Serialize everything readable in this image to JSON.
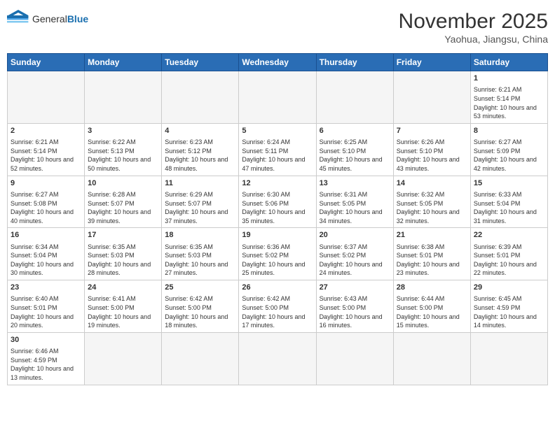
{
  "header": {
    "logo_general": "General",
    "logo_blue": "Blue",
    "month_year": "November 2025",
    "location": "Yaohua, Jiangsu, China"
  },
  "days_of_week": [
    "Sunday",
    "Monday",
    "Tuesday",
    "Wednesday",
    "Thursday",
    "Friday",
    "Saturday"
  ],
  "weeks": [
    [
      {
        "day": "",
        "info": ""
      },
      {
        "day": "",
        "info": ""
      },
      {
        "day": "",
        "info": ""
      },
      {
        "day": "",
        "info": ""
      },
      {
        "day": "",
        "info": ""
      },
      {
        "day": "",
        "info": ""
      },
      {
        "day": "1",
        "info": "Sunrise: 6:21 AM\nSunset: 5:14 PM\nDaylight: 10 hours and 53 minutes."
      }
    ],
    [
      {
        "day": "2",
        "info": "Sunrise: 6:21 AM\nSunset: 5:14 PM\nDaylight: 10 hours and 52 minutes."
      },
      {
        "day": "3",
        "info": "Sunrise: 6:22 AM\nSunset: 5:13 PM\nDaylight: 10 hours and 50 minutes."
      },
      {
        "day": "4",
        "info": "Sunrise: 6:23 AM\nSunset: 5:12 PM\nDaylight: 10 hours and 48 minutes."
      },
      {
        "day": "5",
        "info": "Sunrise: 6:24 AM\nSunset: 5:11 PM\nDaylight: 10 hours and 47 minutes."
      },
      {
        "day": "6",
        "info": "Sunrise: 6:25 AM\nSunset: 5:10 PM\nDaylight: 10 hours and 45 minutes."
      },
      {
        "day": "7",
        "info": "Sunrise: 6:26 AM\nSunset: 5:10 PM\nDaylight: 10 hours and 43 minutes."
      },
      {
        "day": "8",
        "info": "Sunrise: 6:27 AM\nSunset: 5:09 PM\nDaylight: 10 hours and 42 minutes."
      }
    ],
    [
      {
        "day": "9",
        "info": "Sunrise: 6:27 AM\nSunset: 5:08 PM\nDaylight: 10 hours and 40 minutes."
      },
      {
        "day": "10",
        "info": "Sunrise: 6:28 AM\nSunset: 5:07 PM\nDaylight: 10 hours and 39 minutes."
      },
      {
        "day": "11",
        "info": "Sunrise: 6:29 AM\nSunset: 5:07 PM\nDaylight: 10 hours and 37 minutes."
      },
      {
        "day": "12",
        "info": "Sunrise: 6:30 AM\nSunset: 5:06 PM\nDaylight: 10 hours and 35 minutes."
      },
      {
        "day": "13",
        "info": "Sunrise: 6:31 AM\nSunset: 5:05 PM\nDaylight: 10 hours and 34 minutes."
      },
      {
        "day": "14",
        "info": "Sunrise: 6:32 AM\nSunset: 5:05 PM\nDaylight: 10 hours and 32 minutes."
      },
      {
        "day": "15",
        "info": "Sunrise: 6:33 AM\nSunset: 5:04 PM\nDaylight: 10 hours and 31 minutes."
      }
    ],
    [
      {
        "day": "16",
        "info": "Sunrise: 6:34 AM\nSunset: 5:04 PM\nDaylight: 10 hours and 30 minutes."
      },
      {
        "day": "17",
        "info": "Sunrise: 6:35 AM\nSunset: 5:03 PM\nDaylight: 10 hours and 28 minutes."
      },
      {
        "day": "18",
        "info": "Sunrise: 6:35 AM\nSunset: 5:03 PM\nDaylight: 10 hours and 27 minutes."
      },
      {
        "day": "19",
        "info": "Sunrise: 6:36 AM\nSunset: 5:02 PM\nDaylight: 10 hours and 25 minutes."
      },
      {
        "day": "20",
        "info": "Sunrise: 6:37 AM\nSunset: 5:02 PM\nDaylight: 10 hours and 24 minutes."
      },
      {
        "day": "21",
        "info": "Sunrise: 6:38 AM\nSunset: 5:01 PM\nDaylight: 10 hours and 23 minutes."
      },
      {
        "day": "22",
        "info": "Sunrise: 6:39 AM\nSunset: 5:01 PM\nDaylight: 10 hours and 22 minutes."
      }
    ],
    [
      {
        "day": "23",
        "info": "Sunrise: 6:40 AM\nSunset: 5:01 PM\nDaylight: 10 hours and 20 minutes."
      },
      {
        "day": "24",
        "info": "Sunrise: 6:41 AM\nSunset: 5:00 PM\nDaylight: 10 hours and 19 minutes."
      },
      {
        "day": "25",
        "info": "Sunrise: 6:42 AM\nSunset: 5:00 PM\nDaylight: 10 hours and 18 minutes."
      },
      {
        "day": "26",
        "info": "Sunrise: 6:42 AM\nSunset: 5:00 PM\nDaylight: 10 hours and 17 minutes."
      },
      {
        "day": "27",
        "info": "Sunrise: 6:43 AM\nSunset: 5:00 PM\nDaylight: 10 hours and 16 minutes."
      },
      {
        "day": "28",
        "info": "Sunrise: 6:44 AM\nSunset: 5:00 PM\nDaylight: 10 hours and 15 minutes."
      },
      {
        "day": "29",
        "info": "Sunrise: 6:45 AM\nSunset: 4:59 PM\nDaylight: 10 hours and 14 minutes."
      }
    ],
    [
      {
        "day": "30",
        "info": "Sunrise: 6:46 AM\nSunset: 4:59 PM\nDaylight: 10 hours and 13 minutes."
      },
      {
        "day": "",
        "info": ""
      },
      {
        "day": "",
        "info": ""
      },
      {
        "day": "",
        "info": ""
      },
      {
        "day": "",
        "info": ""
      },
      {
        "day": "",
        "info": ""
      },
      {
        "day": "",
        "info": ""
      }
    ]
  ]
}
